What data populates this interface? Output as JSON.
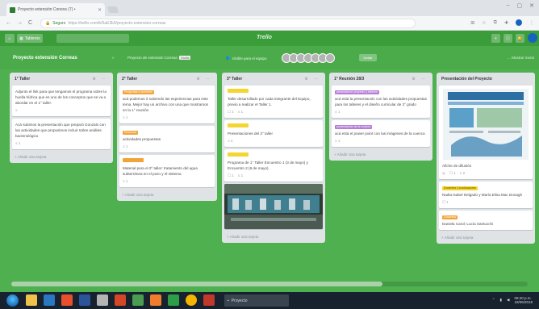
{
  "browser": {
    "tab_title": "Proyecto extensión Conexs (7) •",
    "url": "https://trello.com/b/5aE3k0/proyecto-extension-correas",
    "secure": "Seguro"
  },
  "trello": {
    "boards_button": "Tableros",
    "logo": "Trello"
  },
  "board": {
    "title": "Proyecto extensión Correas",
    "team": "Proyecto de extensión Correas",
    "team_badge": "Gratis",
    "visibility": "Visible para el equipo",
    "invite": "Invitar",
    "show_menu": "… Mostrar menú"
  },
  "lists": [
    {
      "title": "1° Taller",
      "cards": [
        {
          "text": "Adjunto el link para que tengamos el programa sobre la huella hídrica que es uno de los conceptos que se va a abordar en el 1° taller.",
          "badges": [
            "≡"
          ]
        },
        {
          "text": "Acá subimos la presentación que preparó Gonzalo con las actividades que propusimos incluir sobre análisis bacteriológico",
          "badges": [
            "≡ 1"
          ]
        }
      ],
      "add": "+ Añadir otra tarjeta"
    },
    {
      "title": "2° Taller",
      "cards": [
        {
          "label": "Preguntas a docentes",
          "text": "acá podemos ir subiendo las experiencias para este tema. Mejor hay un archivo con una que mostramos en la 1° reunión",
          "badges": [
            "≡ 1"
          ]
        },
        {
          "label": "Recursos",
          "text": "actividades propuestas",
          "badges": [
            "≡ 1"
          ]
        },
        {
          "label": "",
          "text": "Material para el 2º taller: tratamiento del agua subterránea en el pozo y el sistema",
          "badges": [
            "≡ 1"
          ]
        }
      ],
      "add": "+ Añadir otra tarjeta"
    },
    {
      "title": "3° Taller",
      "cards": [
        {
          "label": "",
          "text": "Taller desarrollado por cada integrante del Equipo, previo a realizar el Taller 1.",
          "badges": [
            "☐ 1",
            "≡ 1"
          ]
        },
        {
          "label": "",
          "text": "Presentaciones del 3° taller",
          "badges": [
            "≡ 4"
          ]
        },
        {
          "label": "",
          "text": "Programa de 1° Taller Encuentro 1 (3 de mayo) y Encuentro 2 (8 de mayo)",
          "badges": [
            "☐ 1",
            "≡ 1"
          ]
        }
      ],
      "add": "+ Añadir otra tarjeta"
    },
    {
      "title": "1° Reunión 28/3",
      "cards": [
        {
          "label": "presentación proyecto y talleres",
          "text": "acá está la presentación con las actividades propuestas para los talleres y el diseño curricular de 3° grado",
          "badges": [
            "≡ 1"
          ]
        },
        {
          "label": "presentación de la reunión",
          "text": "acá está el power point con las imágenes de la cuenca",
          "badges": [
            "≡ 1"
          ]
        }
      ],
      "add": "+ Añadir otra tarjeta"
    },
    {
      "title": "Presentación del Proyecto",
      "cards": [
        {
          "label": "",
          "text": "Afiche de difusión",
          "badges": [
            "◎",
            "☐ 1",
            "≡ 2"
          ],
          "has_image": true
        },
        {
          "label": "Docentes Coordinadores",
          "text": "Nadia Isabel Delgado y María Elisa Mac Donagh",
          "badges": [
            "☐ 1"
          ]
        },
        {
          "label": "Docentes",
          "text": "Daniela Carol; Lucía Santucchi",
          "badges": []
        }
      ],
      "add": "+ Añadir otra tarjeta"
    }
  ],
  "taskbar": {
    "app_label": "Proyecto",
    "time": "09:40 p.m.",
    "date": "18/06/2018"
  },
  "colors": {
    "board_bg": "#4fb04f",
    "header": "#3a9d3a",
    "label_orange": "#f2a43a",
    "label_yellow": "#f5d532",
    "label_purple": "#b77ed8"
  }
}
